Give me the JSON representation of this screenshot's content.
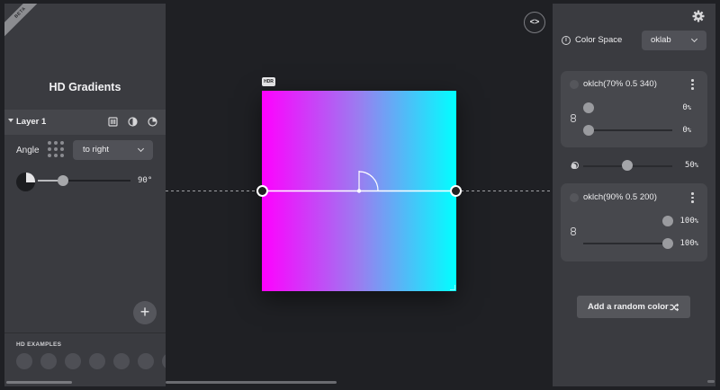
{
  "app": {
    "title": "HD Gradients",
    "beta_label": "BETA"
  },
  "layer": {
    "name": "Layer 1",
    "icons": [
      "gradient-linear-icon",
      "gradient-radial-icon",
      "gradient-conic-icon"
    ]
  },
  "angle": {
    "label": "Angle",
    "direction": "to right",
    "value": 90,
    "value_display": "90°",
    "range": [
      0,
      360
    ]
  },
  "examples": {
    "title": "HD EXAMPLES",
    "count": 7
  },
  "canvas": {
    "hdr_badge": "HDR",
    "code_button": "<>",
    "gradient": {
      "angle_deg": 90,
      "stops": [
        "#ff00ff",
        "#9a7df0",
        "#00ffff"
      ]
    }
  },
  "settings": {
    "color_space_label": "Color Space",
    "color_space_value": "oklab"
  },
  "colors": [
    {
      "label": "oklch(70% 0.5 340)",
      "stop1": 0,
      "stop1_display": "0",
      "stop2": 0,
      "stop2_display": "0",
      "unit": "%"
    },
    {
      "label": "oklch(90% 0.5 200)",
      "stop1": 100,
      "stop1_display": "100",
      "stop2": 100,
      "stop2_display": "100",
      "unit": "%"
    }
  ],
  "midpoint": {
    "value": 50,
    "value_display": "50",
    "unit": "%"
  },
  "actions": {
    "random_color": "Add a random color"
  },
  "theme": {
    "accent": "#ffffff",
    "panel_bg": "#3a3b40",
    "card_bg": "#47484d",
    "canvas_bg": "#1f2024"
  }
}
